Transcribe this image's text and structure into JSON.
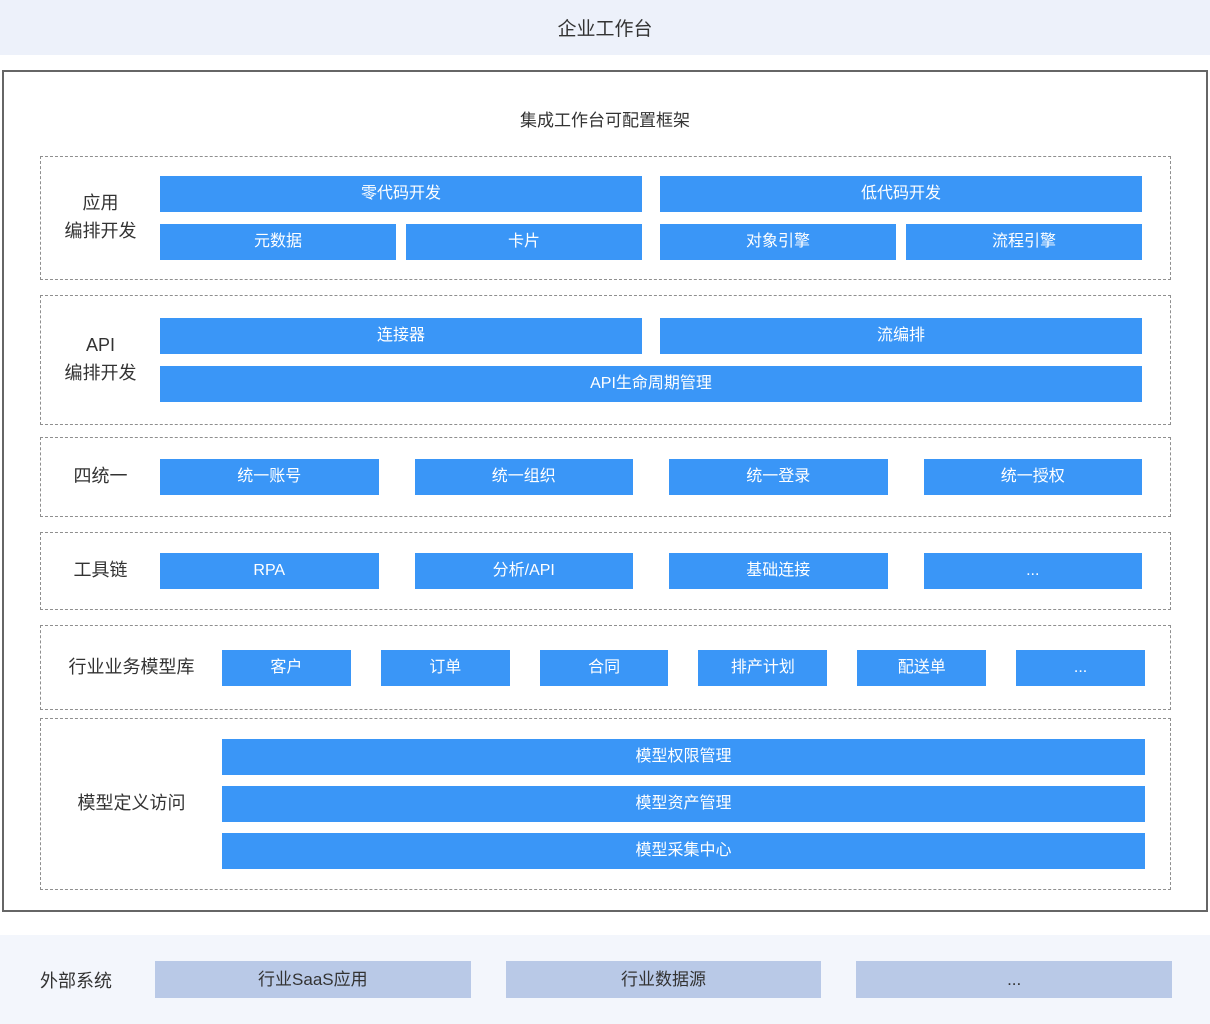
{
  "banner": {
    "title": "企业工作台"
  },
  "frame": {
    "title": "集成工作台可配置框架",
    "section1": {
      "label_line1": "应用",
      "label_line2": "编排开发",
      "row1": [
        "零代码开发",
        "低代码开发"
      ],
      "row2": [
        "元数据",
        "卡片",
        "对象引擎",
        "流程引擎"
      ]
    },
    "section2": {
      "label_line1": "API",
      "label_line2": "编排开发",
      "row1": [
        "连接器",
        "流编排"
      ],
      "row2": [
        "API生命周期管理"
      ]
    },
    "section3": {
      "label": "四统一",
      "blocks": [
        "统一账号",
        "统一组织",
        "统一登录",
        "统一授权"
      ]
    },
    "section4": {
      "label": "工具链",
      "blocks": [
        "RPA",
        "分析/API",
        "基础连接",
        "..."
      ]
    },
    "section5": {
      "label": "行业业务模型库",
      "blocks": [
        "客户",
        "订单",
        "合同",
        "排产计划",
        "配送单",
        "..."
      ]
    },
    "section6": {
      "label": "模型定义访问",
      "blocks": [
        "模型权限管理",
        "模型资产管理",
        "模型采集中心"
      ]
    }
  },
  "footer": {
    "label": "外部系统",
    "blocks": [
      "行业SaaS应用",
      "行业数据源",
      "..."
    ]
  },
  "colors": {
    "block_blue": "#3a96f7",
    "footer_block_blue_gray": "#b9c9e7",
    "banner_bg": "#edf1fa",
    "footer_bg": "#f3f6fc",
    "frame_border": "#666666",
    "dashed_border": "#8f8f8f"
  }
}
